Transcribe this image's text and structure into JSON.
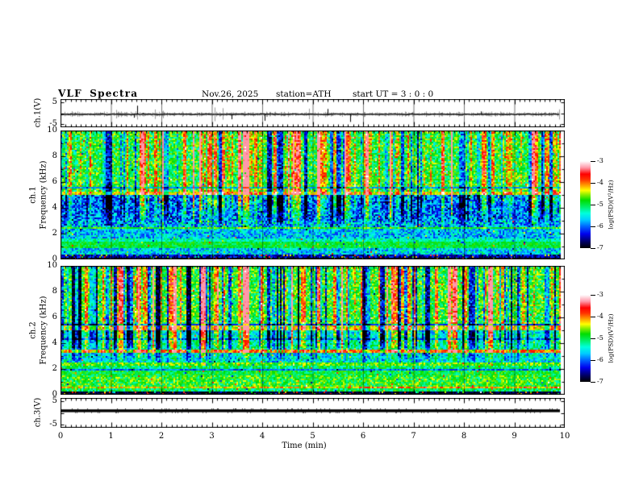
{
  "header": {
    "title": "VLF Spectra",
    "date": "Nov.26, 2025",
    "station": "station=ATH",
    "start_ut": "start UT =  3 : 0 : 0"
  },
  "x_axis": {
    "label": "Time (min)",
    "range": [
      0,
      10
    ],
    "ticks": [
      0,
      1,
      2,
      3,
      4,
      5,
      6,
      7,
      8,
      9,
      10
    ]
  },
  "colormap": {
    "stops": [
      [
        -7.0,
        "#000000"
      ],
      [
        -6.7,
        "#000066"
      ],
      [
        -6.35,
        "#0000ee"
      ],
      [
        -6.0,
        "#0066ff"
      ],
      [
        -5.7,
        "#00ccff"
      ],
      [
        -5.4,
        "#00ffdd"
      ],
      [
        -5.1,
        "#00ee66"
      ],
      [
        -4.8,
        "#00dd00"
      ],
      [
        -4.55,
        "#88ee00"
      ],
      [
        -4.35,
        "#ffff00"
      ],
      [
        -4.1,
        "#ff9900"
      ],
      [
        -3.85,
        "#ff3300"
      ],
      [
        -3.6,
        "#ff0000"
      ],
      [
        -3.3,
        "#ff99aa"
      ],
      [
        -3.0,
        "#ffffff"
      ]
    ]
  },
  "chart_data": [
    {
      "id": "ch1_waveform",
      "type": "line",
      "ylabel": "ch.1(V)",
      "ylim": [
        -6.5,
        6.5
      ],
      "yticks": [
        5,
        -5
      ],
      "xlim": [
        0,
        10
      ],
      "baseline": -0.5,
      "noise": 0.35,
      "spike_rate": 0.02,
      "spike_max": 3.8,
      "seed": 42,
      "description": "noisy black trace near 0 V with narrow up/down spikes"
    },
    {
      "id": "ch1_spectrogram",
      "type": "heatmap",
      "ylabel_line1": "ch.1",
      "ylabel_line2": "Frequency (kHz)",
      "ylim": [
        0,
        10
      ],
      "yticks": [
        10,
        8,
        6,
        4,
        2,
        0
      ],
      "value_range": [
        -7,
        -3
      ],
      "seed": 23,
      "colorbar": {
        "label": "log(PSD)(V²/Hz)",
        "ticks": [
          -3,
          -4,
          -5,
          -6,
          -7
        ]
      },
      "bands": [
        {
          "f": [
            5.2,
            10.01
          ],
          "v": -4.9,
          "n": 0.55
        },
        {
          "f": [
            4.95,
            5.2
          ],
          "v": -4.3,
          "n": 0.35
        },
        {
          "f": [
            3.0,
            4.95
          ],
          "v": -6.0,
          "n": 0.65
        },
        {
          "f": [
            2.5,
            3.0
          ],
          "v": -5.8,
          "n": 0.75
        },
        {
          "f": [
            2.35,
            2.5
          ],
          "v": -4.8,
          "n": 0.3
        },
        {
          "f": [
            1.6,
            2.35
          ],
          "v": -5.7,
          "n": 0.55
        },
        {
          "f": [
            1.35,
            1.6
          ],
          "v": -5.3,
          "n": 0.35
        },
        {
          "f": [
            0.9,
            1.35
          ],
          "v": -4.95,
          "n": 0.3
        },
        {
          "f": [
            0.35,
            0.9
          ],
          "v": -5.6,
          "n": 0.55
        },
        {
          "f": [
            0.15,
            0.35
          ],
          "v": -6.5,
          "n": 0.45,
          "speckle": 0.08
        },
        {
          "f": [
            0.0,
            0.15
          ],
          "v": -6.9,
          "n": 0.25,
          "speckle": 0.1
        }
      ],
      "hlines": [
        {
          "f": 5.6,
          "v": -5.9
        }
      ],
      "stripes": {
        "density": 0.45,
        "dark": 0.38,
        "bright": 0.47,
        "red": 0.15,
        "dark_mag": [
          -1.6,
          -0.5
        ],
        "bright_mag": [
          0.5,
          1.2
        ],
        "red_mag": [
          1.6,
          2.3
        ],
        "full_above": 4.5,
        "fade_to": 2.0
      }
    },
    {
      "id": "ch2_spectrogram",
      "type": "heatmap",
      "ylabel_line1": "ch.2",
      "ylabel_line2": "Frequency (kHz)",
      "ylim": [
        0,
        10
      ],
      "yticks": [
        10,
        8,
        6,
        4,
        2,
        0
      ],
      "value_range": [
        -7,
        -3
      ],
      "seed": 77,
      "colorbar": {
        "label": "log(PSD)(V²/Hz)",
        "ticks": [
          -3,
          -4,
          -5,
          -6,
          -7
        ]
      },
      "bands": [
        {
          "f": [
            5.45,
            10.01
          ],
          "v": -4.85,
          "n": 0.55
        },
        {
          "f": [
            4.95,
            5.45
          ],
          "v": -4.35,
          "n": 0.4
        },
        {
          "f": [
            4.35,
            4.95
          ],
          "v": -5.5,
          "n": 0.5
        },
        {
          "f": [
            4.2,
            4.35
          ],
          "v": -6.1,
          "n": 0.4
        },
        {
          "f": [
            3.45,
            4.2
          ],
          "v": -5.25,
          "n": 0.5
        },
        {
          "f": [
            3.25,
            3.45
          ],
          "v": -3.95,
          "n": 0.3
        },
        {
          "f": [
            2.45,
            3.25
          ],
          "v": -5.5,
          "n": 0.55
        },
        {
          "f": [
            2.25,
            2.45
          ],
          "v": -4.7,
          "n": 0.4
        },
        {
          "f": [
            2.0,
            2.25
          ],
          "v": -5.1,
          "n": 0.4
        },
        {
          "f": [
            1.9,
            2.0
          ],
          "v": -6.0,
          "n": 0.3
        },
        {
          "f": [
            1.55,
            1.9
          ],
          "v": -4.95,
          "n": 0.4
        },
        {
          "f": [
            1.45,
            1.55
          ],
          "v": -5.9,
          "n": 0.3
        },
        {
          "f": [
            0.65,
            1.45
          ],
          "v": -4.85,
          "n": 0.5
        },
        {
          "f": [
            0.45,
            0.65
          ],
          "v": -4.3,
          "n": 0.45,
          "right_boost": 0.5
        },
        {
          "f": [
            0.2,
            0.45
          ],
          "v": -5.05,
          "n": 0.45
        },
        {
          "f": [
            0.0,
            0.2
          ],
          "v": -6.85,
          "n": 0.3,
          "speckle": 0.12
        }
      ],
      "hlines": [
        {
          "f": 5.48,
          "v": -6.2
        }
      ],
      "stripes": {
        "density": 0.5,
        "dark": 0.5,
        "bright": 0.35,
        "red": 0.15,
        "dark_mag": [
          -2.2,
          -0.6
        ],
        "bright_mag": [
          0.5,
          1.1
        ],
        "red_mag": [
          1.4,
          2.0
        ],
        "full_above": 4.5,
        "fade_to": 2.2
      }
    },
    {
      "id": "ch3_waveform",
      "type": "line",
      "ylabel": "ch.3(V)",
      "ylim": [
        -6.5,
        6.5
      ],
      "yticks": [
        5,
        -5
      ],
      "xlim": [
        0,
        10
      ],
      "baseline": 0.9,
      "flat": true,
      "thickness": 3.4,
      "seed": 7,
      "description": "flat thick black line (constant level), no signal"
    }
  ]
}
